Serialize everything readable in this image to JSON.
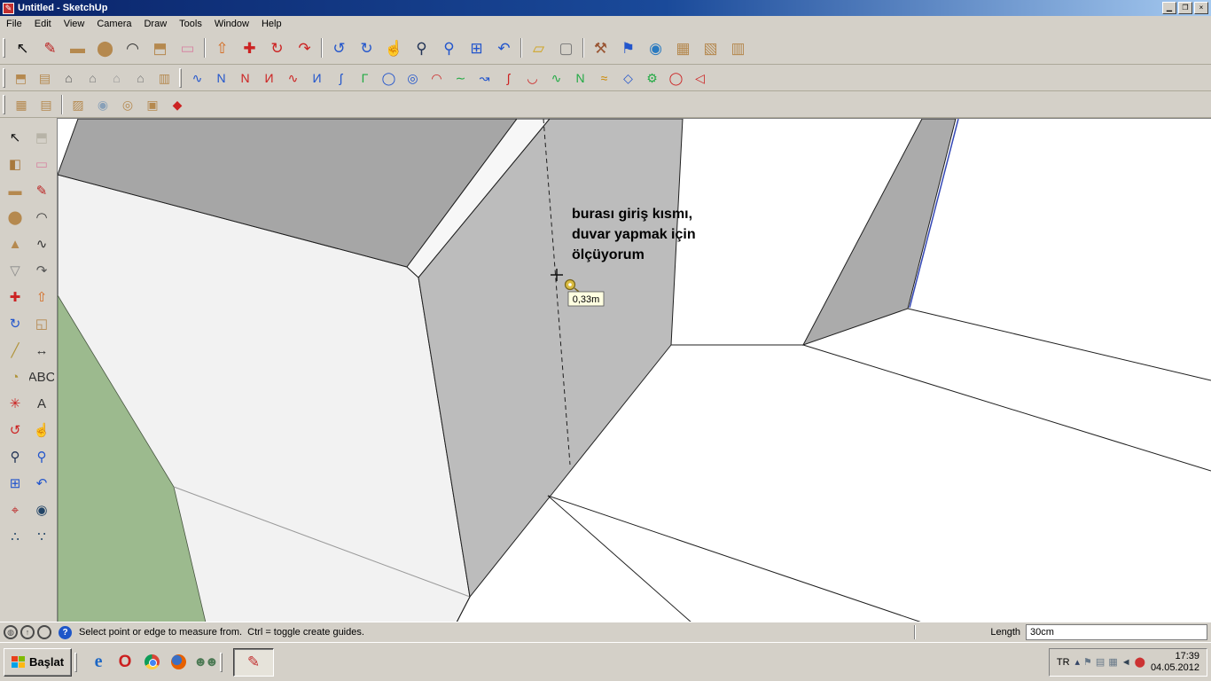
{
  "window": {
    "title": "Untitled - SketchUp"
  },
  "titlebar": {
    "minimize_glyph": "▁",
    "restore_glyph": "❐",
    "close_glyph": "×",
    "app_glyph": "✎"
  },
  "menu": {
    "items": [
      "File",
      "Edit",
      "View",
      "Camera",
      "Draw",
      "Tools",
      "Window",
      "Help"
    ]
  },
  "colors": {
    "face_white": "#f2f2f2",
    "face_light": "#f7f7f7",
    "face_dark_top": "#a6a6a6",
    "face_gray_center": "#bcbcbc",
    "face_gray_right": "#ababab",
    "terrain_green": "#9cba8e",
    "edge": "#1f1f1f",
    "guide_blue": "#3548b5",
    "tooltip_bg": "#ffffe1"
  },
  "toolbars": {
    "main": [
      {
        "name": "select-tool",
        "glyph": "↖",
        "color": "#111111"
      },
      {
        "name": "line-tool",
        "glyph": "✎",
        "color": "#bb2222"
      },
      {
        "name": "rectangle-tool",
        "glyph": "▬",
        "color": "#b5894f"
      },
      {
        "name": "circle-tool",
        "glyph": "⬤",
        "color": "#b5894f"
      },
      {
        "name": "arc-tool",
        "glyph": "◠",
        "color": "#333333"
      },
      {
        "name": "make-component-tool",
        "glyph": "⬒",
        "color": "#b5894f"
      },
      {
        "name": "eraser-tool",
        "glyph": "▭",
        "color": "#d687a3"
      },
      {
        "sep": true
      },
      {
        "name": "push-pull-tool",
        "glyph": "⇧",
        "color": "#d4691e"
      },
      {
        "name": "move-tool",
        "glyph": "✚",
        "color": "#cc2222"
      },
      {
        "name": "rotate-tool",
        "glyph": "↻",
        "color": "#cc2222"
      },
      {
        "name": "follow-me-tool",
        "glyph": "↷",
        "color": "#cc2222"
      },
      {
        "sep": true
      },
      {
        "name": "offset-tool",
        "glyph": "↺",
        "color": "#2255cc"
      },
      {
        "name": "orbit-tool",
        "glyph": "↻",
        "color": "#2255cc"
      },
      {
        "name": "pan-tool",
        "glyph": "☝",
        "color": "#b5894f"
      },
      {
        "name": "zoom-tool",
        "glyph": "⚲",
        "color": "#223355"
      },
      {
        "name": "zoom-window-tool",
        "glyph": "⚲",
        "color": "#2255cc"
      },
      {
        "name": "zoom-extents-tool",
        "glyph": "⊞",
        "color": "#2255cc"
      },
      {
        "name": "previous-view-tool",
        "glyph": "↶",
        "color": "#2255cc"
      },
      {
        "sep": true
      },
      {
        "name": "section-plane-tool",
        "glyph": "▱",
        "color": "#cfa21a"
      },
      {
        "name": "add-scene-button",
        "glyph": "▢",
        "color": "#777777"
      },
      {
        "sep": true
      },
      {
        "name": "get-models-button",
        "glyph": "⚒",
        "color": "#995533"
      },
      {
        "name": "share-model-button",
        "glyph": "⚑",
        "color": "#2255cc"
      },
      {
        "name": "google-earth-button",
        "glyph": "◉",
        "color": "#2a7ac0"
      },
      {
        "name": "add-location-button",
        "glyph": "▦",
        "color": "#b5894f"
      },
      {
        "name": "toggle-terrain-button",
        "glyph": "▧",
        "color": "#b5894f"
      },
      {
        "name": "photo-textures-button",
        "glyph": "▥",
        "color": "#b5894f"
      }
    ],
    "views": [
      {
        "name": "iso-view-button",
        "glyph": "⬒",
        "color": "#b5894f"
      },
      {
        "name": "top-view-button",
        "glyph": "▤",
        "color": "#b5894f"
      },
      {
        "name": "front-view-button",
        "glyph": "⌂",
        "color": "#555555"
      },
      {
        "name": "right-view-button",
        "glyph": "⌂",
        "color": "#777777"
      },
      {
        "name": "back-view-button",
        "glyph": "⌂",
        "color": "#999999"
      },
      {
        "name": "left-view-button",
        "glyph": "⌂",
        "color": "#777777"
      },
      {
        "name": "bottom-view-button",
        "glyph": "▥",
        "color": "#b5894f"
      }
    ],
    "curves": [
      {
        "name": "curve-polyline-tool",
        "glyph": "∿",
        "color": "#2255cc"
      },
      {
        "name": "curve-bezier-tool",
        "glyph": "N",
        "color": "#2255cc"
      },
      {
        "name": "curve-cubic-tool",
        "glyph": "N",
        "color": "#cc2222"
      },
      {
        "name": "curve-quadratic-tool",
        "glyph": "И",
        "color": "#cc2222"
      },
      {
        "name": "curve-fspline-tool",
        "glyph": "∿",
        "color": "#cc2222"
      },
      {
        "name": "curve-bspline-tool",
        "glyph": "И",
        "color": "#2255cc"
      },
      {
        "name": "curve-catmull-tool",
        "glyph": "ʃ",
        "color": "#2255cc"
      },
      {
        "name": "curve-courbette-tool",
        "glyph": "Γ",
        "color": "#22aa44"
      },
      {
        "name": "curve-circle-tool",
        "glyph": "◯",
        "color": "#2255cc"
      },
      {
        "name": "curve-spiral-tool",
        "glyph": "◎",
        "color": "#2255cc"
      },
      {
        "name": "curve-arc3pt-tool",
        "glyph": "◠",
        "color": "#cc2222"
      },
      {
        "name": "curve-sinus-tool",
        "glyph": "∼",
        "color": "#22aa44"
      },
      {
        "name": "curve-scurve-tool",
        "glyph": "↝",
        "color": "#2255cc"
      },
      {
        "name": "curve-jspline-tool",
        "glyph": "ʃ",
        "color": "#cc2222"
      },
      {
        "name": "curve-halfarc-tool",
        "glyph": "◡",
        "color": "#cc2222"
      },
      {
        "name": "curve-smooth-tool",
        "glyph": "∿",
        "color": "#22aa44"
      },
      {
        "name": "curve-divide-tool",
        "glyph": "N",
        "color": "#22aa44"
      },
      {
        "name": "curve-freehand-tool",
        "glyph": "≈",
        "color": "#cc8800"
      },
      {
        "name": "curve-polygon-tool",
        "glyph": "◇",
        "color": "#2255cc"
      },
      {
        "name": "curve-settings-tool",
        "glyph": "⚙",
        "color": "#22aa44"
      },
      {
        "name": "curve-loop-tool",
        "glyph": "◯",
        "color": "#cc2222"
      },
      {
        "name": "curve-triangle-tool",
        "glyph": "◁",
        "color": "#cc2222"
      }
    ],
    "sandbox": [
      {
        "name": "sandbox-from-contours-tool",
        "glyph": "▦",
        "color": "#b5894f"
      },
      {
        "name": "sandbox-from-scratch-tool",
        "glyph": "▤",
        "color": "#b5894f"
      },
      {
        "sep": true
      },
      {
        "name": "sandbox-smoove-tool",
        "glyph": "▨",
        "color": "#b5894f"
      },
      {
        "name": "sandbox-stamp-tool",
        "glyph": "◉",
        "color": "#88a0b8"
      },
      {
        "name": "sandbox-drape-tool",
        "glyph": "◎",
        "color": "#b5894f"
      },
      {
        "name": "sandbox-add-detail-tool",
        "glyph": "▣",
        "color": "#b5894f"
      },
      {
        "name": "sandbox-flip-edge-tool",
        "glyph": "◆",
        "color": "#cc2222"
      }
    ]
  },
  "palette": [
    {
      "name": "select-tool",
      "glyph": "↖",
      "color": "#111111"
    },
    {
      "name": "make-component-tool",
      "glyph": "⬒",
      "color": "#b7b3a7"
    },
    {
      "name": "paint-bucket-tool",
      "glyph": "◧",
      "color": "#a8793c"
    },
    {
      "name": "eraser-tool",
      "glyph": "▭",
      "color": "#d687a3"
    },
    {
      "name": "rectangle-tool",
      "glyph": "▬",
      "color": "#b5894f"
    },
    {
      "name": "line-tool",
      "glyph": "✎",
      "color": "#bb2222"
    },
    {
      "name": "circle-tool",
      "glyph": "⬤",
      "color": "#b5894f"
    },
    {
      "name": "arc-tool",
      "glyph": "◠",
      "color": "#333333"
    },
    {
      "name": "polygon-tool",
      "glyph": "▲",
      "color": "#b5894f"
    },
    {
      "name": "freehand-tool",
      "glyph": "∿",
      "color": "#333333"
    },
    {
      "name": "offset-tool",
      "glyph": "▽",
      "color": "#8a8a8a"
    },
    {
      "name": "follow-me-tool",
      "glyph": "↷",
      "color": "#555555"
    },
    {
      "name": "move-tool",
      "glyph": "✚",
      "color": "#cc2222"
    },
    {
      "name": "push-pull-tool",
      "glyph": "⇧",
      "color": "#d4691e"
    },
    {
      "name": "rotate-tool",
      "glyph": "↻",
      "color": "#2255cc"
    },
    {
      "name": "scale-tool",
      "glyph": "◱",
      "color": "#b5894f"
    },
    {
      "name": "tape-measure-tool",
      "glyph": "╱",
      "color": "#b09339"
    },
    {
      "name": "dimension-tool",
      "glyph": "↔",
      "color": "#333333"
    },
    {
      "name": "protractor-tool",
      "glyph": "◔",
      "color": "#b09339"
    },
    {
      "name": "text-tool",
      "glyph": "ABC",
      "color": "#333333"
    },
    {
      "name": "axes-tool",
      "glyph": "✳",
      "color": "#cc2222"
    },
    {
      "name": "3d-text-tool",
      "glyph": "A",
      "color": "#333333"
    },
    {
      "name": "orbit-tool",
      "glyph": "↺",
      "color": "#cc2222"
    },
    {
      "name": "pan-tool",
      "glyph": "☝",
      "color": "#b5894f"
    },
    {
      "name": "zoom-tool",
      "glyph": "⚲",
      "color": "#223355"
    },
    {
      "name": "zoom-window-tool",
      "glyph": "⚲",
      "color": "#2255cc"
    },
    {
      "name": "zoom-extents-tool",
      "glyph": "⊞",
      "color": "#2255cc"
    },
    {
      "name": "previous-view-tool",
      "glyph": "↶",
      "color": "#2255cc"
    },
    {
      "name": "position-camera-tool",
      "glyph": "⌖",
      "color": "#bb2222"
    },
    {
      "name": "look-around-tool",
      "glyph": "◉",
      "color": "#224466"
    },
    {
      "name": "walk-tool",
      "glyph": "∴",
      "color": "#224466"
    },
    {
      "name": "walk-steps-tool",
      "glyph": "∵",
      "color": "#224466"
    }
  ],
  "viewport": {
    "annotation_line1": "burası giriş kısmı,",
    "annotation_line2": "duvar yapmak için",
    "annotation_line3": "ölçüyorum",
    "tooltip": "0,33m"
  },
  "statusbar": {
    "icons": [
      {
        "name": "statusbar-geolocation-button",
        "glyph": "◍"
      },
      {
        "name": "statusbar-credits-button",
        "glyph": "↑"
      },
      {
        "name": "statusbar-model-button",
        "glyph": ""
      }
    ],
    "help_glyph": "?",
    "hint": "Select point or edge to measure from.  Ctrl = toggle create guides.",
    "length_label": "Length",
    "length_value": "30cm"
  },
  "taskbar": {
    "start": "Başlat",
    "ie_glyph": "e",
    "opera_glyph": "O",
    "users_glyph": "☻☻",
    "sketchup_glyph": "✎",
    "tray": {
      "lang": "TR",
      "icons": [
        {
          "name": "tray-expand-icon",
          "glyph": "▴",
          "color": "#334466"
        },
        {
          "name": "tray-flag-icon",
          "glyph": "⚑",
          "color": "#667788"
        },
        {
          "name": "tray-window-icon",
          "glyph": "▤",
          "color": "#667788"
        },
        {
          "name": "tray-display-icon",
          "glyph": "▦",
          "color": "#667788"
        },
        {
          "name": "tray-volume-icon",
          "glyph": "◄",
          "color": "#334455"
        },
        {
          "name": "tray-opera-icon",
          "glyph": "⬤",
          "color": "#cc3333"
        }
      ],
      "time": "17:39",
      "date": "04.05.2012"
    }
  }
}
